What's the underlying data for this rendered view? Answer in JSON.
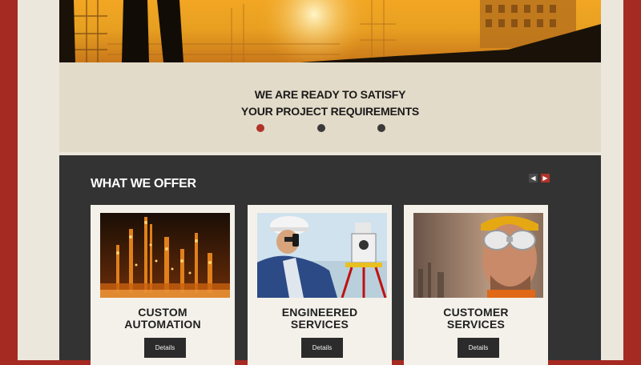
{
  "tagline": {
    "line1": "WE ARE READY TO SATISFY",
    "line2": "YOUR PROJECT REQUIREMENTS"
  },
  "slider": {
    "dots": 3,
    "active_index": 0
  },
  "offer": {
    "title": "WHAT WE OFFER",
    "prev_icon": "chevron-left-icon",
    "next_icon": "chevron-right-icon",
    "cards": [
      {
        "line1": "CUSTOM",
        "line2": "AUTOMATION",
        "button": "Details",
        "image": "refinery-night-image"
      },
      {
        "line1": "ENGINEERED",
        "line2": "SERVICES",
        "button": "Details",
        "image": "surveyor-image"
      },
      {
        "line1": "CUSTOMER",
        "line2": "SERVICES",
        "button": "Details",
        "image": "worker-goggles-image"
      }
    ]
  },
  "colors": {
    "page_border": "#a52a22",
    "accent": "#b0332a",
    "dark_panel": "#333333",
    "hero_orange": "#f2a623"
  }
}
